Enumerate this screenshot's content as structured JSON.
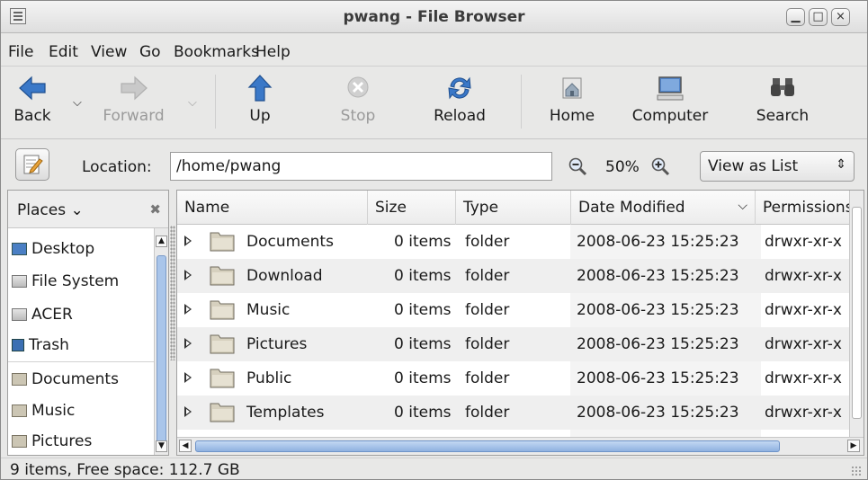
{
  "window": {
    "title": "pwang - File Browser"
  },
  "menu": [
    "File",
    "Edit",
    "View",
    "Go",
    "Bookmarks",
    "Help"
  ],
  "toolbar": {
    "back": "Back",
    "forward": "Forward",
    "up": "Up",
    "stop": "Stop",
    "reload": "Reload",
    "home": "Home",
    "computer": "Computer",
    "search": "Search"
  },
  "location": {
    "label": "Location:",
    "value": "/home/pwang"
  },
  "zoom": {
    "level": "50%"
  },
  "view": {
    "selected": "View as List"
  },
  "sidebar": {
    "header": "Places",
    "items": [
      {
        "label": "Desktop",
        "icon": "desktop-icon"
      },
      {
        "label": "File System",
        "icon": "drive-icon"
      },
      {
        "label": "ACER",
        "icon": "drive-icon"
      },
      {
        "label": "Trash",
        "icon": "trash-icon"
      },
      {
        "label": "Documents",
        "icon": "folder-icon"
      },
      {
        "label": "Music",
        "icon": "folder-icon"
      },
      {
        "label": "Pictures",
        "icon": "folder-icon"
      }
    ]
  },
  "columns": [
    "Name",
    "Size",
    "Type",
    "Date Modified",
    "Permissions"
  ],
  "files": [
    {
      "name": "Documents",
      "size": "0 items",
      "type": "folder",
      "date": "2008-06-23 15:25:23",
      "perm": "drwxr-xr-x"
    },
    {
      "name": "Download",
      "size": "0 items",
      "type": "folder",
      "date": "2008-06-23 15:25:23",
      "perm": "drwxr-xr-x"
    },
    {
      "name": "Music",
      "size": "0 items",
      "type": "folder",
      "date": "2008-06-23 15:25:23",
      "perm": "drwxr-xr-x"
    },
    {
      "name": "Pictures",
      "size": "0 items",
      "type": "folder",
      "date": "2008-06-23 15:25:23",
      "perm": "drwxr-xr-x"
    },
    {
      "name": "Public",
      "size": "0 items",
      "type": "folder",
      "date": "2008-06-23 15:25:23",
      "perm": "drwxr-xr-x"
    },
    {
      "name": "Templates",
      "size": "0 items",
      "type": "folder",
      "date": "2008-06-23 15:25:23",
      "perm": "drwxr-xr-x"
    }
  ],
  "status": "9 items, Free space: 112.7 GB",
  "colors": {
    "accent": "#3a78c8",
    "scrollbar": "#8fb1e0"
  }
}
